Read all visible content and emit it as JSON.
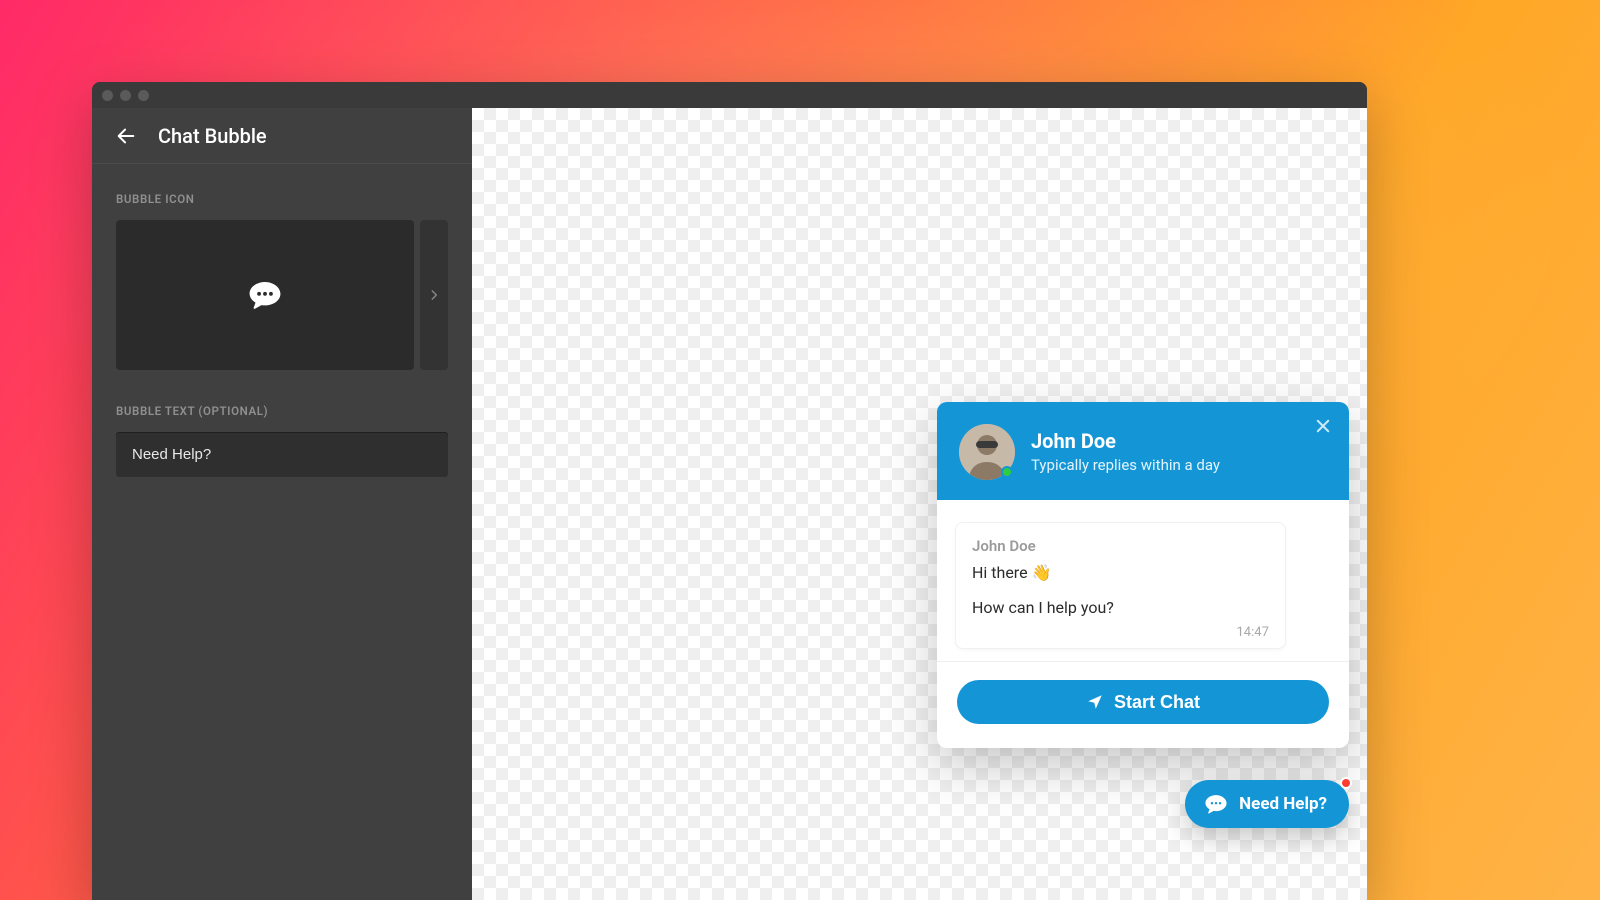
{
  "sidebar": {
    "title": "Chat Bubble",
    "section_icon_label": "BUBBLE ICON",
    "section_text_label": "BUBBLE TEXT (OPTIONAL)",
    "bubble_text_value": "Need Help?"
  },
  "chat": {
    "agent_name": "John Doe",
    "agent_subtitle": "Typically replies within a day",
    "message_from": "John Doe",
    "message_line1": "Hi there 👋",
    "message_line2": "How can I help you?",
    "message_time": "14:47",
    "start_button": "Start Chat"
  },
  "launcher": {
    "label": "Need Help?"
  },
  "colors": {
    "accent": "#1496d6"
  }
}
